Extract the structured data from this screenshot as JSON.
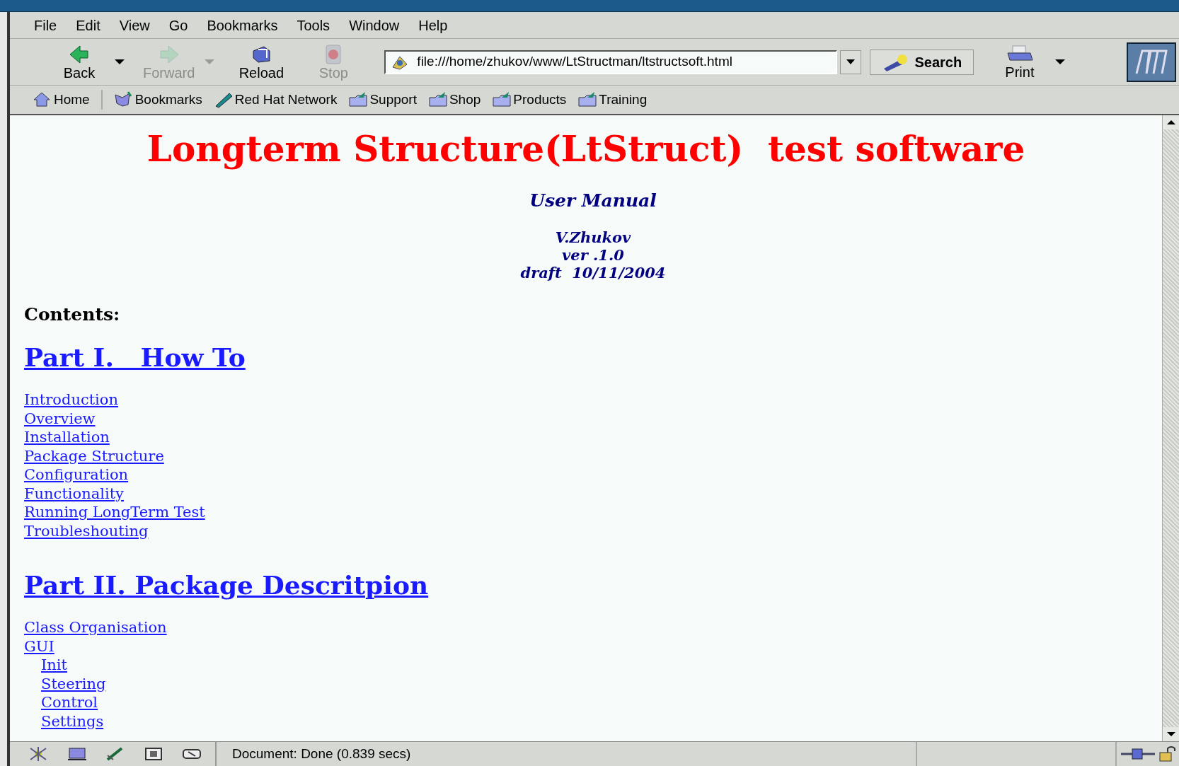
{
  "menu_bar": [
    {
      "label": "File"
    },
    {
      "label": "Edit"
    },
    {
      "label": "View"
    },
    {
      "label": "Go"
    },
    {
      "label": "Bookmarks"
    },
    {
      "label": "Tools"
    },
    {
      "label": "Window"
    },
    {
      "label": "Help"
    }
  ],
  "nav_toolbar": [
    {
      "kind": "back",
      "label": "Back",
      "disabled": false,
      "dropdown": true
    },
    {
      "kind": "forward",
      "label": "Forward",
      "disabled": true,
      "dropdown": true
    },
    {
      "kind": "reload",
      "label": "Reload",
      "disabled": false,
      "dropdown": false
    },
    {
      "kind": "stop",
      "label": "Stop",
      "disabled": true,
      "dropdown": false
    }
  ],
  "address": {
    "value": "file:///home/zhukov/www/LtStructman/ltstructsoft.html"
  },
  "search_button": "Search",
  "print_button": "Print",
  "personal_toolbar": [
    {
      "kind": "home",
      "label": "Home"
    },
    {
      "kind": "bookmarks",
      "label": "Bookmarks"
    },
    {
      "kind": "network",
      "label": "Red Hat Network"
    },
    {
      "kind": "folder",
      "label": "Support"
    },
    {
      "kind": "folder",
      "label": "Shop"
    },
    {
      "kind": "folder",
      "label": "Products"
    },
    {
      "kind": "folder",
      "label": "Training"
    }
  ],
  "document": {
    "title": "Longterm Structure(LtStruct)  test software",
    "subtitle": "User Manual",
    "author_lines": [
      "V.Zhukov",
      "ver .1.0",
      "draft  10/11/2004"
    ],
    "contents_heading": "Contents:",
    "sections": [
      {
        "heading": "Part I.   How To",
        "links": [
          {
            "text": "Introduction"
          },
          {
            "text": "Overview"
          },
          {
            "text": "Installation"
          },
          {
            "text": "Package Structure"
          },
          {
            "text": "Configuration"
          },
          {
            "text": "Functionality"
          },
          {
            "text": "Running LongTerm Test"
          },
          {
            "text": "Troubleshouting"
          }
        ]
      },
      {
        "heading": "Part II. Package Descritpion",
        "links": [
          {
            "text": "Class Organisation"
          },
          {
            "text": "GUI",
            "children": [
              {
                "text": "Init"
              },
              {
                "text": "Steering"
              },
              {
                "text": "Control"
              },
              {
                "text": "Settings"
              }
            ]
          }
        ]
      }
    ]
  },
  "status_bar": {
    "text": "Document: Done (0.839 secs)"
  }
}
